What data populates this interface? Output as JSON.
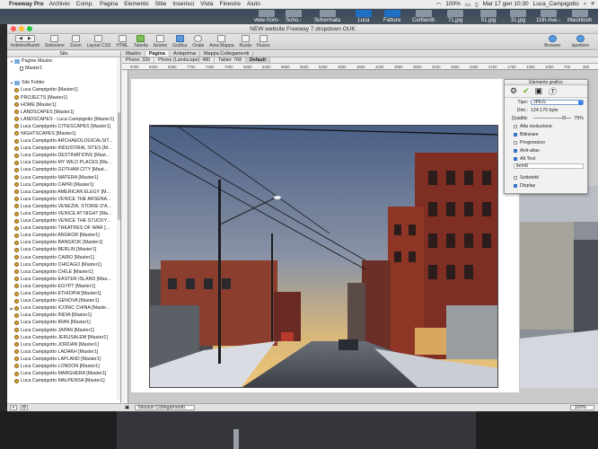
{
  "menubar": {
    "app": "Freeway Pro",
    "items": [
      "Archivio",
      "Comp.",
      "Pagina",
      "Elemento",
      "Stile",
      "Inserisci",
      "Vista",
      "Finestre",
      "Aiuto"
    ],
    "battery": "100%",
    "clock": "Mar 17 gen  10:30",
    "user": "Luca_Campigotto"
  },
  "desktop": {
    "items": [
      "view-from-",
      "Soho,-",
      "Schermata",
      "Luca",
      "Fattura",
      "Cortlandt-",
      "71.jpg",
      "51.jpg",
      "31.jpg",
      "11th-Ave.-",
      "Macintosh"
    ]
  },
  "window": {
    "title": "NEW website Freeway 7 dropdown OUK"
  },
  "toolbar": {
    "buttons": [
      "Indietro/Avanti",
      "Selezione",
      "Zoom",
      "Layout CSS",
      "HTML",
      "Tabella",
      "Azione",
      "Grafica",
      "Ovale",
      "Area Mappa",
      "Ruota",
      "Flusso"
    ],
    "right": [
      "Browser",
      "Ispettore"
    ]
  },
  "sidebar": {
    "title": "Sito",
    "master_group": "Pagine Mastro",
    "master_item": "Master1",
    "site_folder": "Site Folder",
    "pages": [
      "Luca Campigotto [Master1]",
      "PROJECTS [Master1]",
      "HOME [Master1]",
      "LANDSCAPES [Master1]",
      "LANDSCAPES - Luca Campigotto [Master1]",
      "Luca Campigotto CITIESCAPES [Master1]",
      "NIGHTSCAPES [Master1]",
      "Luca Campigotto ARCHAEOLOGICALSIT...",
      "Luca Campigotto INDUSTRIAL SITES [M...",
      "Luca Campigotto DESTINATIONS [Mast...",
      "Luca Campigotto MY WILD PLACES [Ma...",
      "Luca Campigotto GOTHAM CITY [Mast...",
      "Luca Campigotto MATERA [Master1]",
      "Luca Campigotto CAPRI [Master1]",
      "Luca Campigotto AMERICAN ELEGY [M...",
      "Luca Campigotto VENICE THE ARSENA...",
      "Luca Campigotto VENEZIA, STORIE D'A...",
      "Luca Campigotto VENICE AT NIGHT [Ma...",
      "Luca Campigotto VENICE THE STUCKY...",
      "Luca Campigotto THEATRES OF WAR [...",
      "Luca Campigotto ANGKOR [Master1]",
      "Luca Campigotto BANGKOK [Master1]",
      "Luca Campigotto BERLIN [Master1]",
      "Luca Campigotto CAIRO [Master1]",
      "Luca Campigotto CHICAGO [Master1]",
      "Luca Campigotto CHILE [Master1]",
      "Luca Campigotto EASTER ISLAND [Mas...",
      "Luca Campigotto EGYPT [Master1]",
      "Luca Campigotto ETHIOPIA [Master1]",
      "Luca Campigotto GENOVA [Master1]",
      "Luca Campigotto ICONIC CHINA [Maste...",
      "Luca Campigotto INDIA [Master1]",
      "Luca Campigotto IRAN [Master1]",
      "Luca Campigotto JAPAN [Master1]",
      "Luca Campigotto JERUSALEM [Master1]",
      "Luca Campigotto JORDAN [Master1]",
      "Luca Campigotto LADAKH [Master1]",
      "Luca Campigotto LAPLAND [Master1]",
      "Luca Campigotto LONDON [Master1]",
      "Luca Campigotto MARGHERA [Master1]",
      "Luca Campigotto MALPENSA [Master1]"
    ]
  },
  "main": {
    "tabs": [
      "Mastro",
      "Pagina",
      "Anteprima",
      "Mappa Collegamenti"
    ],
    "breakpoints": [
      "Phone: 320",
      "Phone (Landscape): 480",
      "Tablet: 768",
      "Default"
    ],
    "ruler": [
      "8750",
      "8400",
      "8050",
      "7700",
      "7350",
      "7000",
      "6650",
      "6300",
      "5950",
      "5600",
      "5250",
      "4900",
      "4550",
      "4200",
      "3850",
      "3500",
      "3150",
      "2800",
      "2450",
      "2100",
      "1750",
      "1400",
      "1050",
      "700",
      "350"
    ],
    "footer_link": "Nessun Collegamento",
    "zoom": "100%"
  },
  "inspector": {
    "title": "Elemento grafico",
    "tipo_label": "Tipo:",
    "tipo_value": "JPEG",
    "dim_label": "Dim.:",
    "dim_value": "124.170 byte",
    "quality_label": "Qualità:",
    "quality_value": "75%",
    "quality": 0.75,
    "options": [
      {
        "label": "Alta risoluzione",
        "checked": false
      },
      {
        "label": "Bilineare",
        "checked": true
      },
      {
        "label": "Progressivo",
        "checked": false
      },
      {
        "label": "Anti-alias",
        "checked": true
      },
      {
        "label": "Alt Text",
        "checked": true
      }
    ],
    "alt_text": "item8",
    "bottom_options": [
      {
        "label": "Sottotetti",
        "checked": false
      },
      {
        "label": "Display",
        "checked": true
      }
    ]
  },
  "colors": {
    "accent": "#3b82e8",
    "window_bg": "#e8e8e8"
  }
}
